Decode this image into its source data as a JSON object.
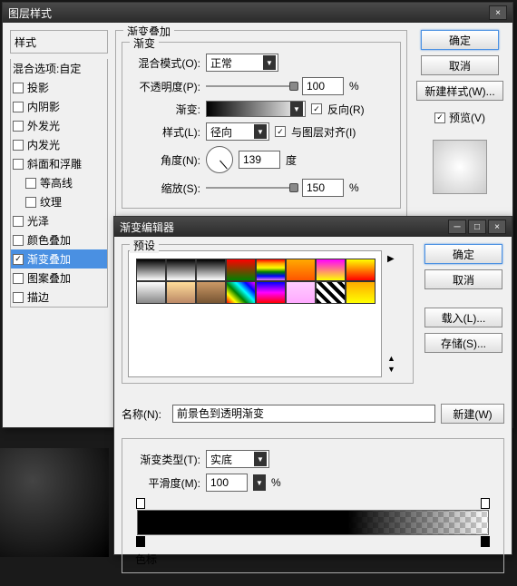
{
  "mainWindow": {
    "title": "图层样式",
    "styles": {
      "header": "样式",
      "blendOptions": "混合选项:自定",
      "items": [
        {
          "label": "投影",
          "checked": false
        },
        {
          "label": "内阴影",
          "checked": false
        },
        {
          "label": "外发光",
          "checked": false
        },
        {
          "label": "内发光",
          "checked": false
        },
        {
          "label": "斜面和浮雕",
          "checked": false
        },
        {
          "label": "等高线",
          "checked": false,
          "indent": true
        },
        {
          "label": "纹理",
          "checked": false,
          "indent": true
        },
        {
          "label": "光泽",
          "checked": false
        },
        {
          "label": "颜色叠加",
          "checked": false
        },
        {
          "label": "渐变叠加",
          "checked": true,
          "selected": true
        },
        {
          "label": "图案叠加",
          "checked": false
        },
        {
          "label": "描边",
          "checked": false
        }
      ]
    },
    "section": {
      "title": "渐变叠加",
      "subtitle": "渐变",
      "blendMode": {
        "label": "混合模式(O):",
        "value": "正常"
      },
      "opacity": {
        "label": "不透明度(P):",
        "value": "100",
        "unit": "%"
      },
      "gradient": {
        "label": "渐变:",
        "reverse": "反向(R)"
      },
      "style": {
        "label": "样式(L):",
        "value": "径向",
        "align": "与图层对齐(I)"
      },
      "angle": {
        "label": "角度(N):",
        "value": "139",
        "unit": "度"
      },
      "scale": {
        "label": "缩放(S):",
        "value": "150",
        "unit": "%"
      }
    },
    "buttons": {
      "ok": "确定",
      "cancel": "取消",
      "newStyle": "新建样式(W)...",
      "preview": "预览(V)"
    }
  },
  "editorWindow": {
    "title": "渐变编辑器",
    "presets": "预设",
    "name": {
      "label": "名称(N):",
      "value": "前景色到透明渐变"
    },
    "newBtn": "新建(W)",
    "gradType": {
      "label": "渐变类型(T):",
      "value": "实底"
    },
    "smooth": {
      "label": "平滑度(M):",
      "value": "100",
      "unit": "%"
    },
    "stops": "色标",
    "buttons": {
      "ok": "确定",
      "cancel": "取消",
      "load": "载入(L)...",
      "save": "存储(S)..."
    }
  }
}
